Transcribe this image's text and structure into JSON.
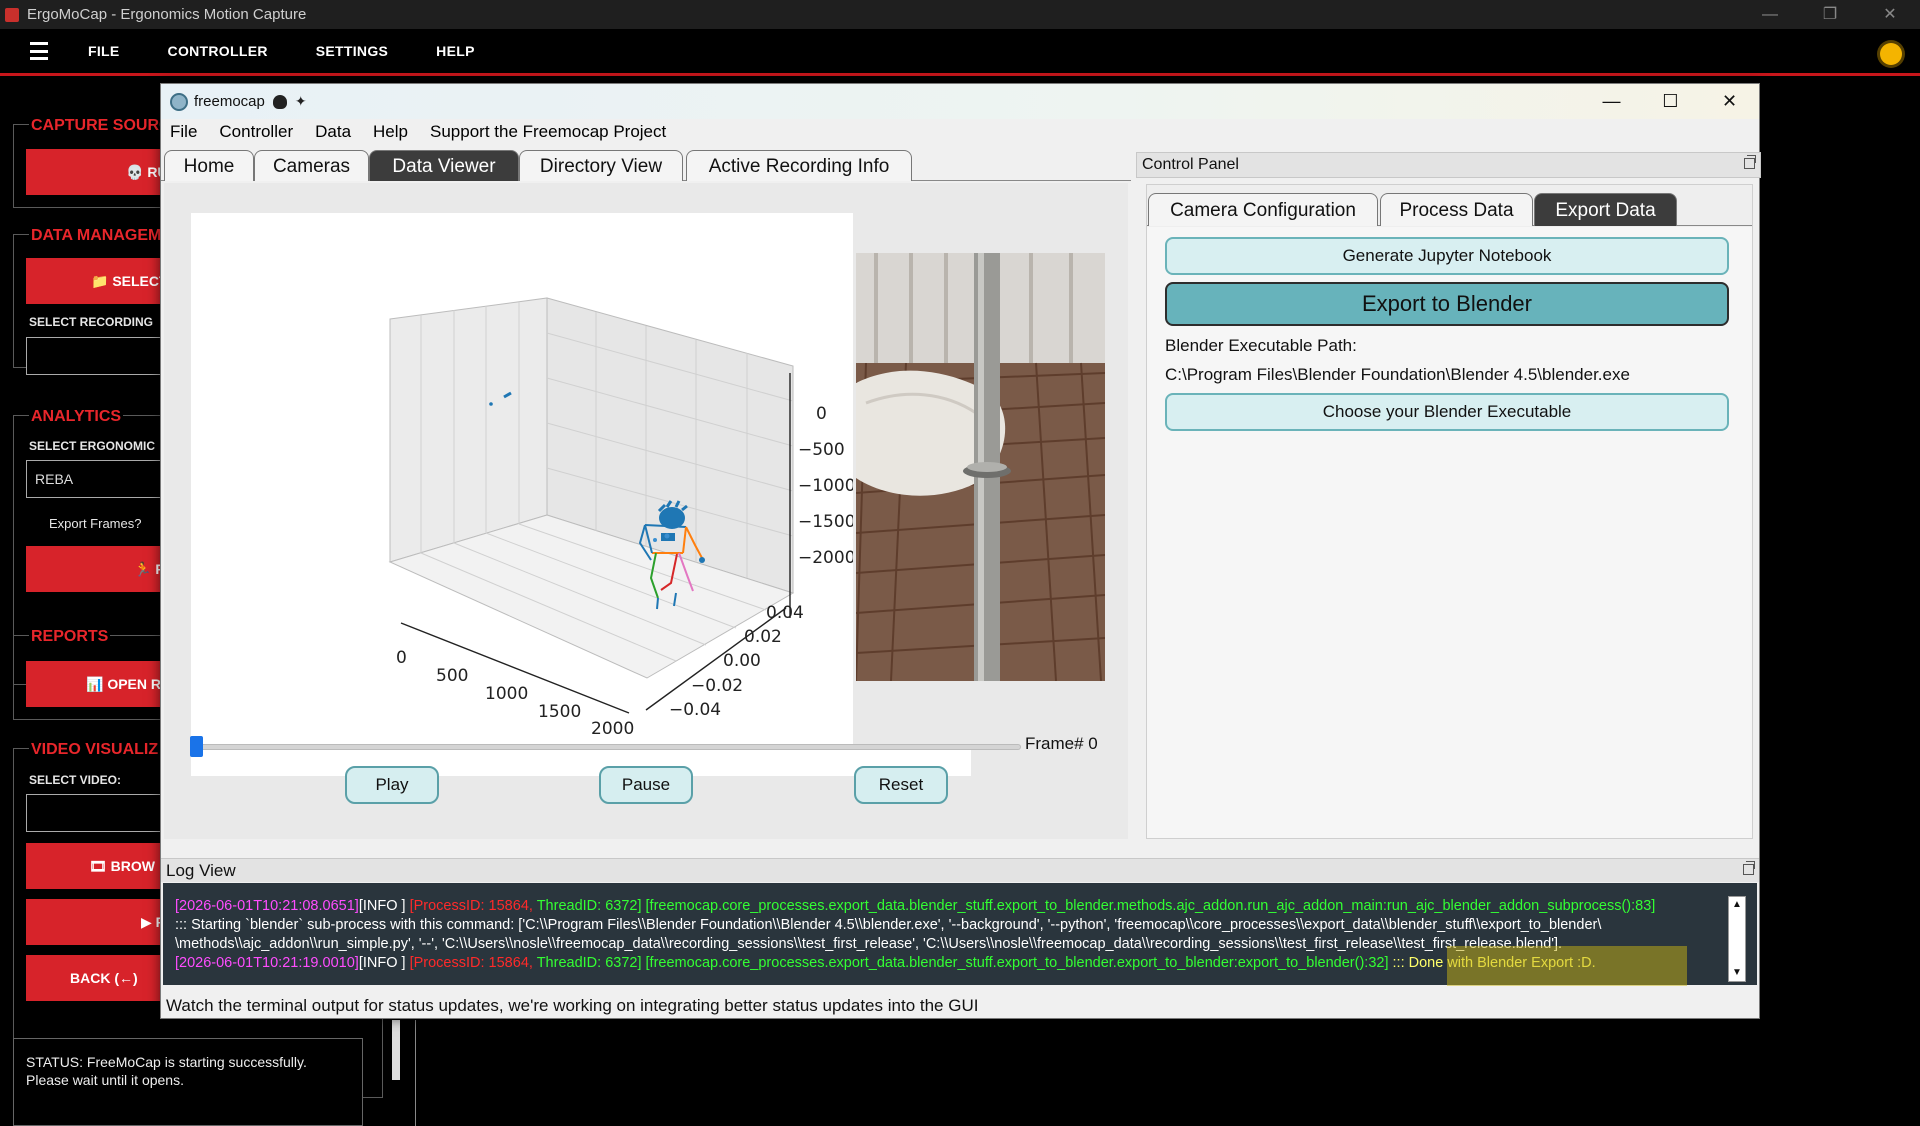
{
  "app": {
    "title": "ErgoMoCap - Ergonomics Motion Capture",
    "window_controls": [
      "—",
      "❐",
      "✕"
    ],
    "menu": [
      "FILE",
      "CONTROLLER",
      "SETTINGS",
      "HELP"
    ]
  },
  "sidebar": {
    "capture_source": {
      "title": "CAPTURE SOURC",
      "button": "💀 RU"
    },
    "data_management": {
      "title": "DATA MANAGEME",
      "button": "📁 SELECT",
      "select_label": "SELECT RECORDING"
    },
    "analytics": {
      "title": "ANALYTICS",
      "select_label": "SELECT ERGONOMIC",
      "select_value": "REBA",
      "export_frames": "Export Frames?",
      "button": "🏃 RU"
    },
    "reports": {
      "title": "REPORTS",
      "button": "📊 OPEN RE"
    },
    "video": {
      "title": "VIDEO VISUALIZ",
      "select_label": "SELECT VIDEO:",
      "browse_button": "🎞 BROW",
      "play_button": "▶ PL",
      "back_button": "BACK (←)"
    },
    "status": "STATUS: FreeMoCap is starting successfully. Please wait until it opens."
  },
  "freemocap": {
    "title": "freemocap",
    "controls": [
      "—",
      "☐",
      "✕"
    ],
    "menu": [
      "File",
      "Controller",
      "Data",
      "Help",
      "Support the Freemocap Project"
    ],
    "tabs": [
      "Home",
      "Cameras",
      "Data Viewer",
      "Directory View",
      "Active Recording Info"
    ],
    "active_tab": "Data Viewer",
    "viewer": {
      "frame_label": "Frame# 0",
      "frame": 0,
      "buttons": {
        "play": "Play",
        "pause": "Pause",
        "reset": "Reset"
      },
      "axis_z_ticks": [
        "0",
        "−500",
        "−1000",
        "−1500",
        "−2000"
      ],
      "axis_x_ticks": [
        "0",
        "500",
        "1000",
        "1500",
        "2000"
      ],
      "axis_y_ticks": [
        "0.04",
        "0.02",
        "0.00",
        "−0.02",
        "−0.04"
      ]
    },
    "control_panel": {
      "title": "Control Panel",
      "tabs": [
        "Camera Configuration",
        "Process Data",
        "Export Data"
      ],
      "active_tab": "Export Data",
      "generate_notebook": "Generate Jupyter Notebook",
      "export_blender": "Export to Blender",
      "blender_path_label": "Blender Executable Path:",
      "blender_path": "C:\\Program Files\\Blender Foundation\\Blender 4.5\\blender.exe",
      "choose_blender": "Choose your Blender Executable"
    },
    "log": {
      "title": "Log View",
      "line1_time": "[2026-06-01T10:21:08.0651]",
      "line1_level": "[INFO ]",
      "line1_pid": "[ProcessID: 15864,",
      "line1_tid": "ThreadID: 6372]",
      "line1_src": "[freemocap.core_processes.export_data.blender_stuff.export_to_blender.methods.ajc_addon.run_ajc_addon_main:run_ajc_blender_addon_subprocess():83]",
      "line2": "::: Starting `blender` sub-process with this command: ['C:\\\\Program Files\\\\Blender Foundation\\\\Blender 4.5\\\\blender.exe', '--background', '--python', 'freemocap\\\\core_processes\\\\export_data\\\\blender_stuff\\\\export_to_blender\\",
      "line3": "\\methods\\\\ajc_addon\\\\run_simple.py', '--', 'C:\\\\Users\\\\nosle\\\\freemocap_data\\\\recording_sessions\\\\test_first_release', 'C:\\\\Users\\\\nosle\\\\freemocap_data\\\\recording_sessions\\\\test_first_release\\\\test_first_release.blend'].",
      "line4_time": "[2026-06-01T10:21:19.0010]",
      "line4_level": "[INFO ]",
      "line4_pid": "[ProcessID: 15864,",
      "line4_tid": "ThreadID: 6372]",
      "line4_src": "[freemocap.core_processes.export_data.blender_stuff.export_to_blender.export_to_blender:export_to_blender():32]",
      "line4_msg": "::: Done with Blender Export :D."
    },
    "statusbar": "Watch the terminal output for status updates, we're working on integrating better status updates into the GUI"
  },
  "colors": {
    "accent_red": "#d7232a",
    "teal": "#67b3bb",
    "log_bg": "#2a353d"
  }
}
